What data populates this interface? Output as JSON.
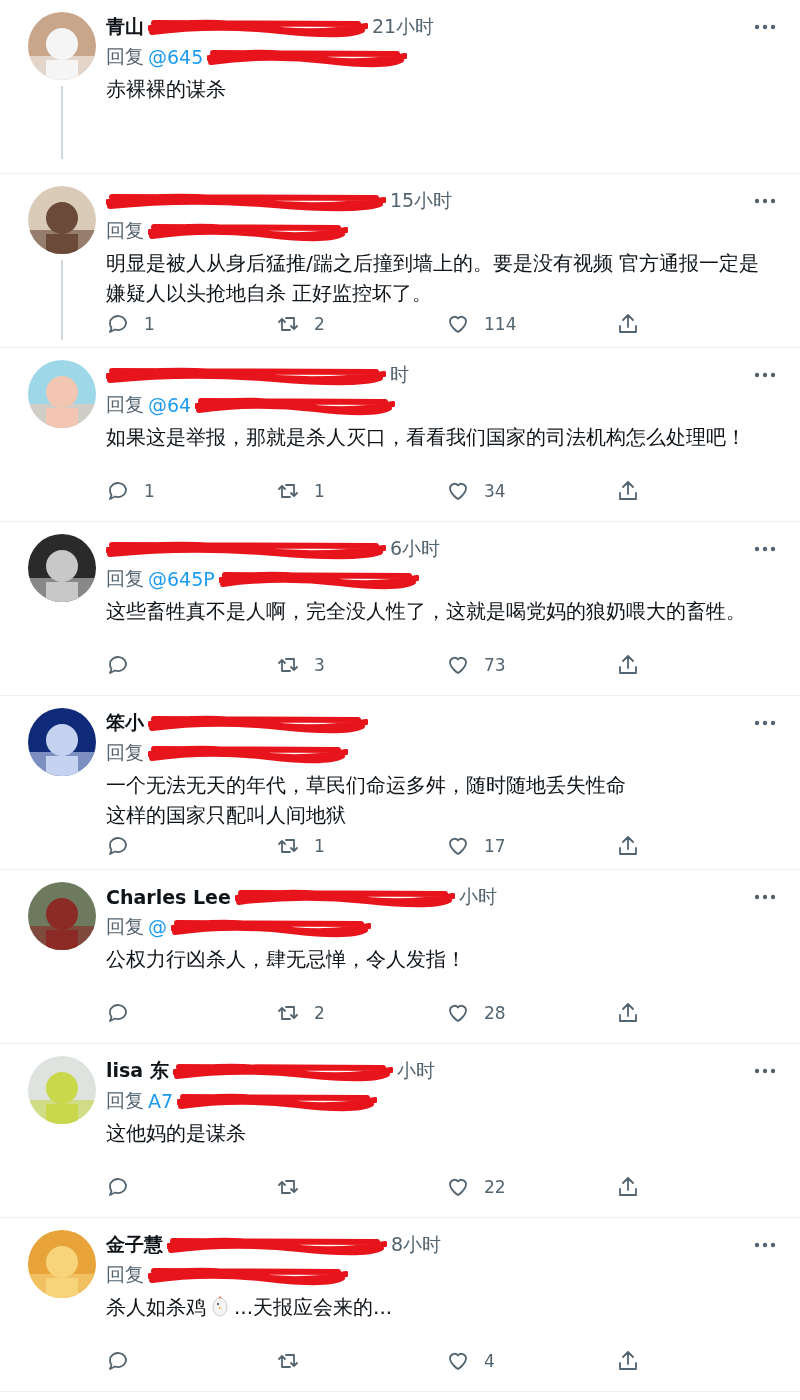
{
  "replies": [
    {
      "name": "青山",
      "time": "21小时",
      "reply_label": "回复",
      "handle": "@645",
      "lines": [
        "赤裸裸的谋杀"
      ],
      "thread_line": true
    },
    {
      "time": "15小时",
      "reply_label": "回复",
      "lines": [
        "明显是被人从身后猛推/踹之后撞到墙上的。要是没有视频  官方通报一定是嫌疑人以头抢地自杀  正好监控坏了。"
      ],
      "thread_line": true,
      "stats": {
        "replies": "1",
        "retweets": "2",
        "likes": "114"
      }
    },
    {
      "time": "时",
      "reply_label": "回复",
      "handle": "@64",
      "lines": [
        "如果这是举报，那就是杀人灭口，看看我们国家的司法机构怎么处理吧！"
      ],
      "thread_line": false,
      "stats": {
        "replies": "1",
        "retweets": "1",
        "likes": "34"
      }
    },
    {
      "time": "6小时",
      "reply_label": "回复",
      "handle": "@645P",
      "lines": [
        "这些畜牲真不是人啊，完全没人性了，这就是喝党妈的狼奶喂大的畜牲。"
      ],
      "thread_line": false,
      "stats": {
        "retweets": "3",
        "likes": "73"
      }
    },
    {
      "name": "笨小",
      "reply_label": "回复",
      "lines": [
        "一个无法无天的年代，草民们命运多舛，随时随地丢失性命",
        "这样的国家只配叫人间地狱"
      ],
      "thread_line": false,
      "stats": {
        "retweets": "1",
        "likes": "17"
      }
    },
    {
      "name": "Charles Lee",
      "time": "小时",
      "reply_label": "回复",
      "handle": "@",
      "lines": [
        "公权力行凶杀人，肆无忌惮，令人发指！"
      ],
      "thread_line": false,
      "stats": {
        "retweets": "2",
        "likes": "28"
      }
    },
    {
      "name": "lisa 东",
      "time": "小时",
      "reply_label": "回复",
      "handle": "A7",
      "lines": [
        "这他妈的是谋杀"
      ],
      "thread_line": false,
      "stats": {
        "likes": "22"
      }
    },
    {
      "name": "金子慧",
      "time": "8小时",
      "reply_label": "回复",
      "lines": [
        "杀人如杀鸡",
        "...天报应会来的..."
      ],
      "inline_icon_after_first": true,
      "thread_line": false,
      "stats": {
        "likes": "4"
      }
    }
  ]
}
